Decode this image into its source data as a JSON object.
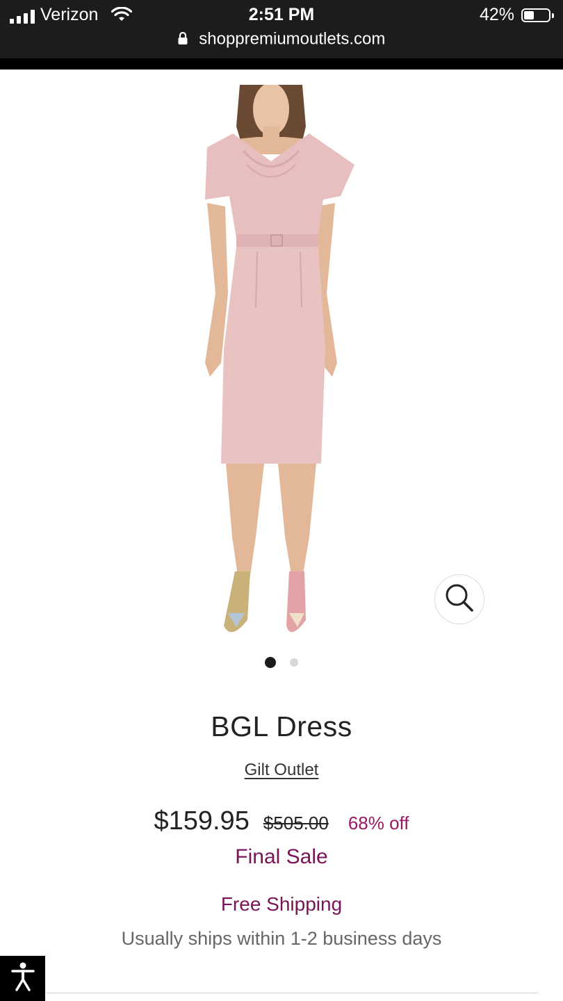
{
  "status_bar": {
    "carrier": "Verizon",
    "time": "2:51 PM",
    "battery_percent": "42%",
    "battery_level": 0.42,
    "signal_bars": 4,
    "url": "shoppremiumoutlets.com"
  },
  "gallery": {
    "image_count": 2,
    "active_index": 0,
    "image_icon": "product-photo-woman-pink-dress",
    "zoom_icon": "magnifier-icon"
  },
  "product": {
    "title": "BGL Dress",
    "brand_link": "Gilt Outlet",
    "price": "$159.95",
    "original_price": "$505.00",
    "discount": "68% off",
    "final_sale": "Final Sale",
    "shipping": "Free Shipping",
    "ships_note": "Usually ships within 1-2 business days"
  },
  "colors": {
    "accent": "#7a1458",
    "discount": "#9a1864",
    "dress": "#e7bfbf"
  },
  "accessibility_icon": "accessibility-person-icon"
}
